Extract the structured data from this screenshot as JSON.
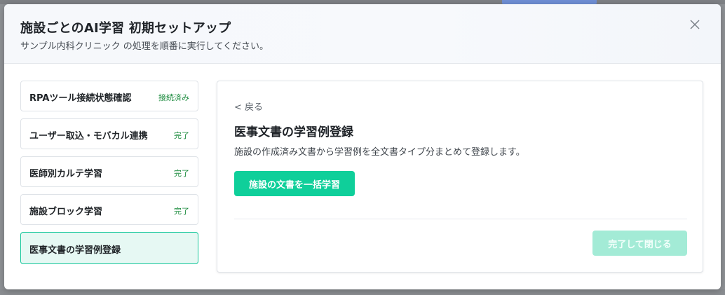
{
  "modal": {
    "title": "施設ごとのAI学習 初期セットアップ",
    "subtitle": "サンプル内科クリニック の処理を順番に実行してください。",
    "close_icon": "close-icon"
  },
  "steps": [
    {
      "label": "RPAツール接続状態確認",
      "status": "接続済み",
      "active": false
    },
    {
      "label": "ユーザー取込・モバカル連携",
      "status": "完了",
      "active": false
    },
    {
      "label": "医師別カルテ学習",
      "status": "完了",
      "active": false
    },
    {
      "label": "施設ブロック学習",
      "status": "完了",
      "active": false
    },
    {
      "label": "医事文書の学習例登録",
      "status": "",
      "active": true
    }
  ],
  "panel": {
    "back_label": "< 戻る",
    "title": "医事文書の学習例登録",
    "description": "施設の作成済み文書から学習例を全文書タイプ分まとめて登録します。",
    "primary_button": "施設の文書を一括学習",
    "finish_button": "完了して閉じる",
    "finish_disabled": true
  },
  "colors": {
    "accent": "#0fcf9a",
    "accent_disabled": "#a3ebd6",
    "active_step_bg": "#e6f8f3",
    "status_green": "#1a8a3c"
  }
}
